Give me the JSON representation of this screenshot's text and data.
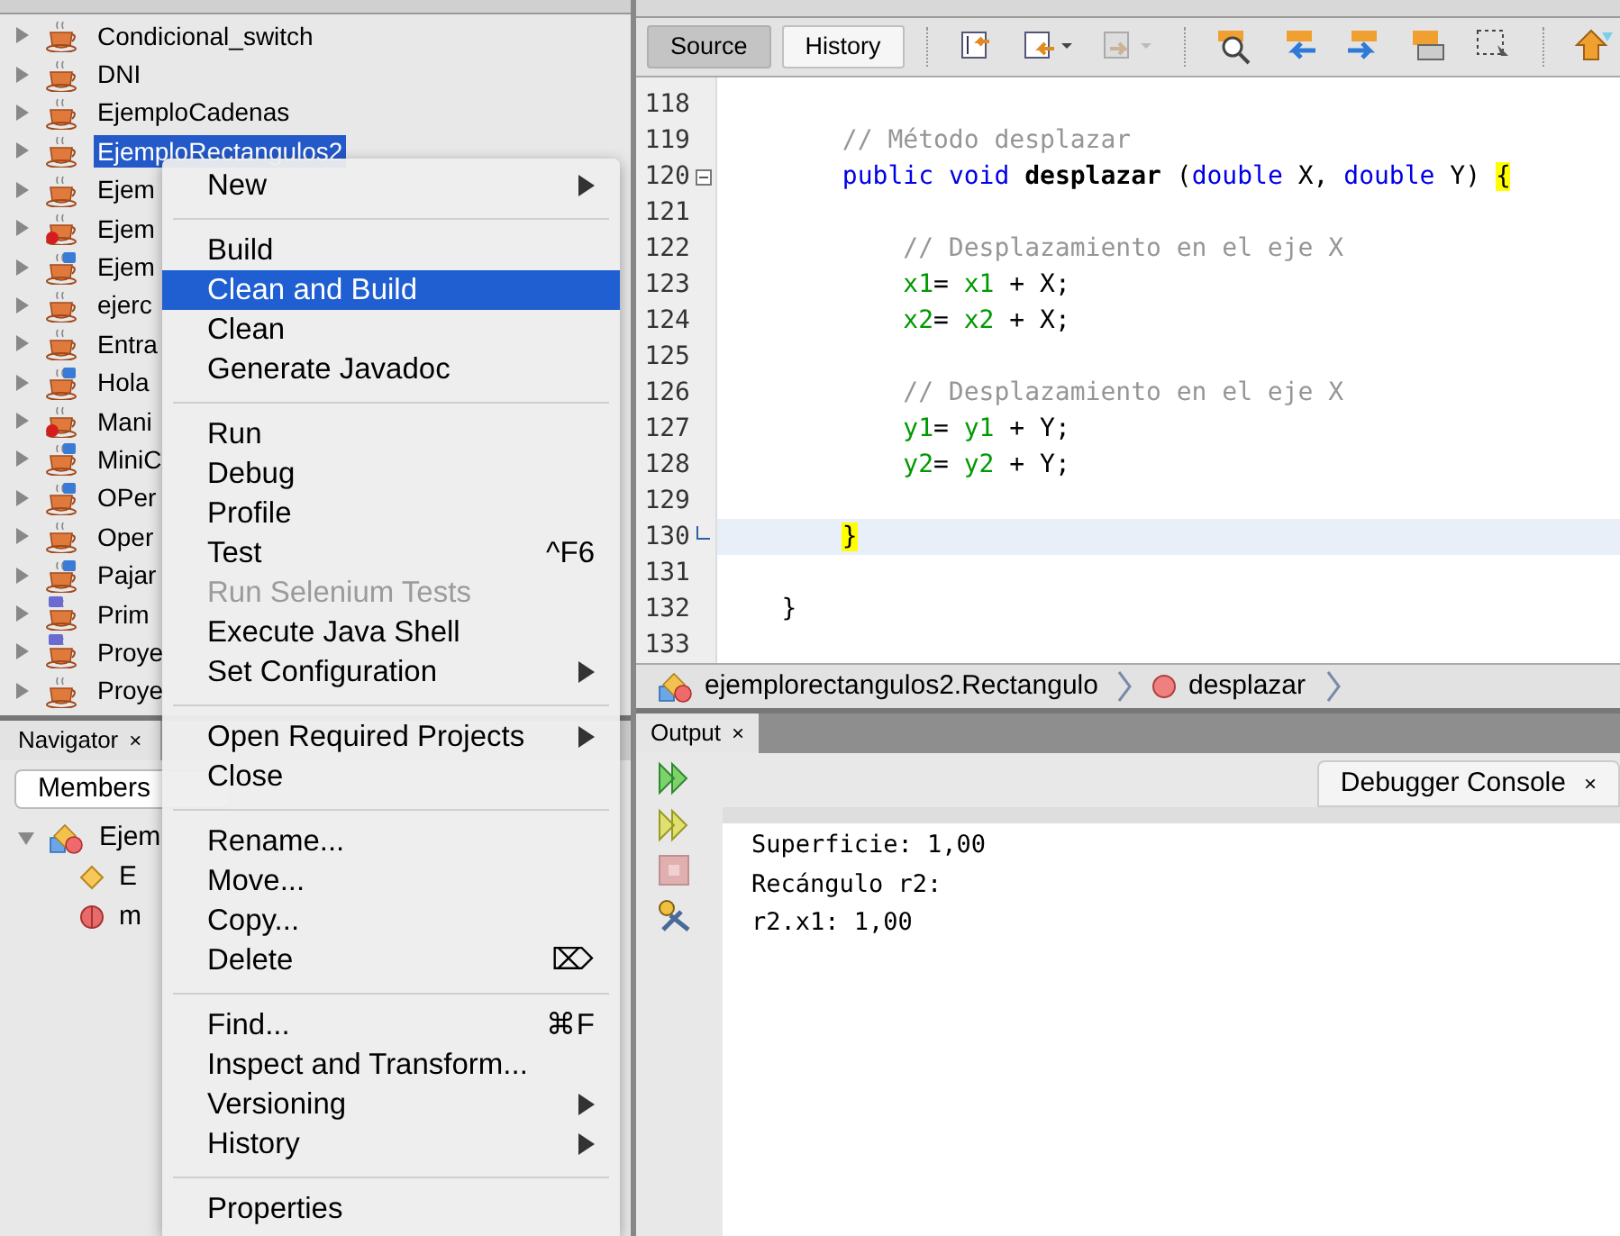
{
  "projects": {
    "items": [
      {
        "label": "Condicional_switch",
        "kind": "plain",
        "selected": false
      },
      {
        "label": "DNI",
        "kind": "plain",
        "selected": false
      },
      {
        "label": "EjemploCadenas",
        "kind": "plain",
        "selected": false
      },
      {
        "label": "EjemploRectangulos2",
        "kind": "plain",
        "selected": true
      },
      {
        "label": "Ejem",
        "kind": "plain",
        "selected": false
      },
      {
        "label": "Ejem",
        "kind": "error",
        "selected": false
      },
      {
        "label": "Ejem",
        "kind": "gui",
        "selected": false
      },
      {
        "label": "ejerc",
        "kind": "plain",
        "selected": false
      },
      {
        "label": "Entra",
        "kind": "plain",
        "selected": false
      },
      {
        "label": "Hola",
        "kind": "gui",
        "selected": false
      },
      {
        "label": "Mani",
        "kind": "error",
        "selected": false
      },
      {
        "label": "MiniC",
        "kind": "gui",
        "selected": false
      },
      {
        "label": "OPer",
        "kind": "gui",
        "selected": false
      },
      {
        "label": "Oper",
        "kind": "plain",
        "selected": false
      },
      {
        "label": "Pajar",
        "kind": "gui",
        "selected": false
      },
      {
        "label": "Prim",
        "kind": "maven",
        "selected": false
      },
      {
        "label": "Proye",
        "kind": "maven",
        "selected": false
      },
      {
        "label": "Proye",
        "kind": "plain",
        "selected": false
      }
    ]
  },
  "navigator": {
    "tab": "Navigator",
    "close": "×",
    "filter": "Members",
    "tree": [
      {
        "label": "Ejem",
        "kind": "class",
        "expanded": true,
        "children": [
          {
            "label": "E",
            "kind": "constructor"
          },
          {
            "label": "m",
            "kind": "method"
          }
        ]
      }
    ]
  },
  "context_menu": {
    "groups": [
      [
        {
          "label": "New",
          "submenu": true,
          "selected": false,
          "disabled": false
        }
      ],
      [
        {
          "label": "Build",
          "submenu": false,
          "selected": false,
          "disabled": false
        },
        {
          "label": "Clean and Build",
          "submenu": false,
          "selected": true,
          "disabled": false
        },
        {
          "label": "Clean",
          "submenu": false,
          "selected": false,
          "disabled": false
        },
        {
          "label": "Generate Javadoc",
          "submenu": false,
          "selected": false,
          "disabled": false
        }
      ],
      [
        {
          "label": "Run",
          "submenu": false,
          "selected": false,
          "disabled": false
        },
        {
          "label": "Debug",
          "submenu": false,
          "selected": false,
          "disabled": false
        },
        {
          "label": "Profile",
          "submenu": false,
          "selected": false,
          "disabled": false
        },
        {
          "label": "Test",
          "shortcut": "^F6",
          "submenu": false,
          "selected": false,
          "disabled": false
        },
        {
          "label": "Run Selenium Tests",
          "submenu": false,
          "selected": false,
          "disabled": true
        },
        {
          "label": "Execute Java Shell",
          "submenu": false,
          "selected": false,
          "disabled": false
        },
        {
          "label": "Set Configuration",
          "submenu": true,
          "selected": false,
          "disabled": false
        }
      ],
      [
        {
          "label": "Open Required Projects",
          "submenu": true,
          "selected": false,
          "disabled": false
        },
        {
          "label": "Close",
          "submenu": false,
          "selected": false,
          "disabled": false
        }
      ],
      [
        {
          "label": "Rename...",
          "submenu": false,
          "selected": false,
          "disabled": false
        },
        {
          "label": "Move...",
          "submenu": false,
          "selected": false,
          "disabled": false
        },
        {
          "label": "Copy...",
          "submenu": false,
          "selected": false,
          "disabled": false
        },
        {
          "label": "Delete",
          "shortcut": "⌦",
          "submenu": false,
          "selected": false,
          "disabled": false
        }
      ],
      [
        {
          "label": "Find...",
          "shortcut": "⌘F",
          "submenu": false,
          "selected": false,
          "disabled": false
        },
        {
          "label": "Inspect and Transform...",
          "submenu": false,
          "selected": false,
          "disabled": false
        },
        {
          "label": "Versioning",
          "submenu": true,
          "selected": false,
          "disabled": false
        },
        {
          "label": "History",
          "submenu": true,
          "selected": false,
          "disabled": false
        }
      ],
      [
        {
          "label": "Properties",
          "submenu": false,
          "selected": false,
          "disabled": false
        }
      ]
    ]
  },
  "editor": {
    "tabs": [
      {
        "label": "Source",
        "selected": true
      },
      {
        "label": "History",
        "selected": false
      }
    ],
    "lines": [
      {
        "number": "118",
        "foldable": false,
        "fold_end": false,
        "current": false
      },
      {
        "number": "119",
        "foldable": false,
        "fold_end": false,
        "current": false,
        "kind": "method",
        "tokens": [
          {
            "text": "// Método desplazar",
            "kind": "comment"
          }
        ]
      },
      {
        "number": "120",
        "foldable": true,
        "fold_end": false,
        "current": false,
        "kind": "method",
        "tokens": [
          {
            "text": "public",
            "kind": "keyword"
          },
          {
            "text": "void",
            "kind": "keyword"
          },
          {
            "text": "desplazar",
            "kind": "method"
          },
          {
            "text": "(",
            "kind": "plain"
          },
          {
            "text": "double",
            "kind": "keyword"
          },
          {
            "text": "X,",
            "kind": "plain"
          },
          {
            "text": "double",
            "kind": "keyword"
          },
          {
            "text": "Y)",
            "kind": "plain"
          },
          {
            "text": "{",
            "kind": "brace"
          }
        ]
      },
      {
        "number": "121",
        "foldable": false,
        "fold_end": false,
        "current": false
      },
      {
        "number": "122",
        "foldable": false,
        "fold_end": false,
        "current": false,
        "kind": "body",
        "tokens": [
          {
            "text": "// Desplazamiento en el eje X",
            "kind": "comment"
          }
        ]
      },
      {
        "number": "123",
        "foldable": false,
        "fold_end": false,
        "current": false,
        "kind": "body",
        "tokens": [
          {
            "text": "x1",
            "kind": "field"
          },
          {
            "text": "=",
            "kind": "plain"
          },
          {
            "text": "x1",
            "kind": "field"
          },
          {
            "text": "+ X;",
            "kind": "plain"
          }
        ]
      },
      {
        "number": "124",
        "foldable": false,
        "fold_end": false,
        "current": false,
        "kind": "body",
        "tokens": [
          {
            "text": "x2",
            "kind": "field"
          },
          {
            "text": "=",
            "kind": "plain"
          },
          {
            "text": "x2",
            "kind": "field"
          },
          {
            "text": "+ X;",
            "kind": "plain"
          }
        ]
      },
      {
        "number": "125",
        "foldable": false,
        "fold_end": false,
        "current": false
      },
      {
        "number": "126",
        "foldable": false,
        "fold_end": false,
        "current": false,
        "kind": "body",
        "tokens": [
          {
            "text": "// Desplazamiento en el eje X",
            "kind": "comment"
          }
        ]
      },
      {
        "number": "127",
        "foldable": false,
        "fold_end": false,
        "current": false,
        "kind": "body",
        "tokens": [
          {
            "text": "y1",
            "kind": "field"
          },
          {
            "text": "=",
            "kind": "plain"
          },
          {
            "text": "y1",
            "kind": "field"
          },
          {
            "text": "+ Y;",
            "kind": "plain"
          }
        ]
      },
      {
        "number": "128",
        "foldable": false,
        "fold_end": false,
        "current": false,
        "kind": "body",
        "tokens": [
          {
            "text": "y2",
            "kind": "field"
          },
          {
            "text": "=",
            "kind": "plain"
          },
          {
            "text": "y2",
            "kind": "field"
          },
          {
            "text": "+ Y;",
            "kind": "plain"
          }
        ]
      },
      {
        "number": "129",
        "foldable": false,
        "fold_end": false,
        "current": false
      },
      {
        "number": "130",
        "foldable": false,
        "fold_end": true,
        "current": true,
        "kind": "method",
        "tokens": [
          {
            "text": "}",
            "kind": "brace"
          }
        ]
      },
      {
        "number": "131",
        "foldable": false,
        "fold_end": false,
        "current": false
      },
      {
        "number": "132",
        "foldable": false,
        "fold_end": false,
        "current": false,
        "kind": "class",
        "tokens": [
          {
            "text": "}",
            "kind": "plain"
          }
        ]
      },
      {
        "number": "133",
        "foldable": false,
        "fold_end": false,
        "current": false
      }
    ]
  },
  "breadcrumb": [
    {
      "label": "ejemplorectangulos2.Rectangulo",
      "kind": "class"
    },
    {
      "label": "desplazar",
      "kind": "method"
    }
  ],
  "output": {
    "tab": "Output",
    "close": "×",
    "console_tab": "Debugger Console",
    "console_close": "×",
    "lines": [
      "Superficie: 1,00",
      "Recángulo r2:",
      "r2.x1: 1,00"
    ]
  }
}
